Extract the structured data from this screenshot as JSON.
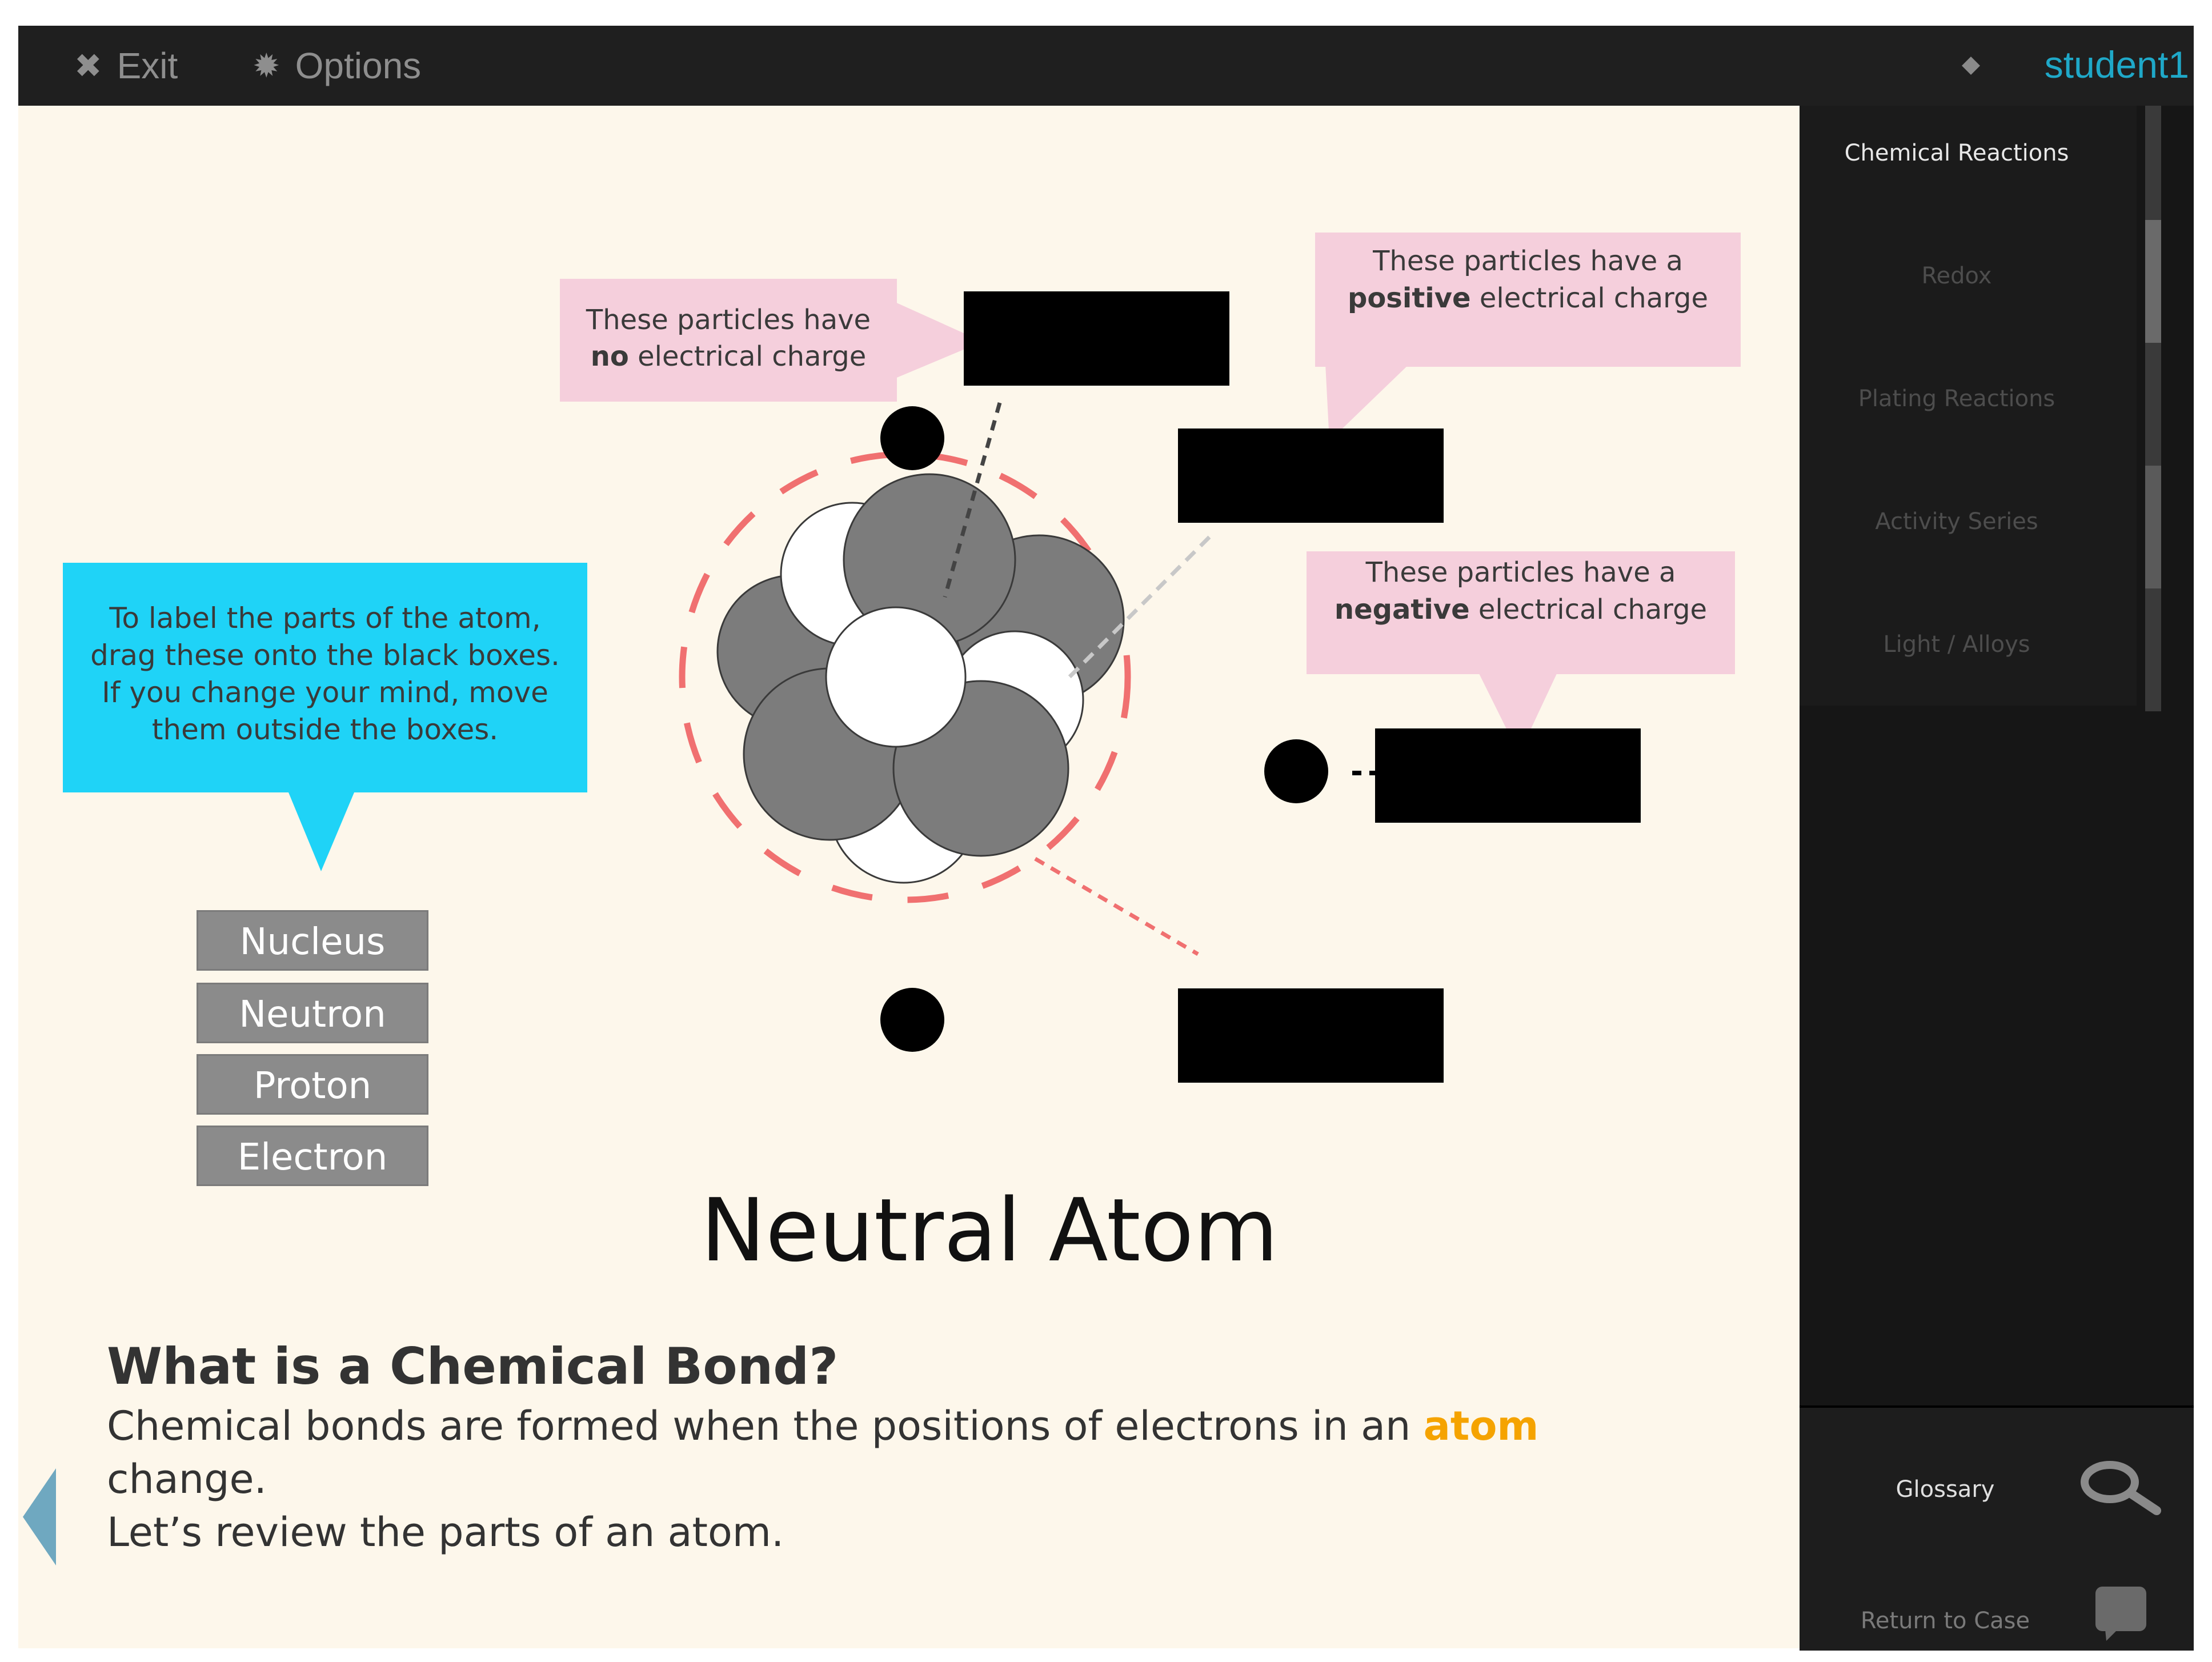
{
  "topbar": {
    "exit_label": "Exit",
    "options_label": "Options",
    "user_name": "student1",
    "exit_icon": "close-icon",
    "options_icon": "gear-icon"
  },
  "sidebar": {
    "items": [
      {
        "label": "Chemical Reactions",
        "active": true
      },
      {
        "label": "Redox",
        "active": false
      },
      {
        "label": "Plating Reactions",
        "active": false
      },
      {
        "label": "Activity Series",
        "active": false
      },
      {
        "label": "Light / Alloys",
        "active": false
      }
    ],
    "glossary_label": "Glossary",
    "return_label": "Return to Case"
  },
  "instructions": {
    "text": "To label the parts of the atom, drag these onto the black boxes. If you change your mind, move them outside the boxes."
  },
  "callouts": {
    "neutral_pre": "These particles have",
    "neutral_bold": "no",
    "neutral_post": "electrical charge",
    "positive_pre": "These particles have a",
    "positive_bold": "positive",
    "positive_post": "electrical charge",
    "negative_pre": "These particles have a",
    "negative_bold": "negative",
    "negative_post": "electrical charge"
  },
  "labels": [
    "Nucleus",
    "Neutron",
    "Proton",
    "Electron"
  ],
  "title": "Neutral Atom",
  "section": {
    "heading": "What is a Chemical Bond?",
    "body_pre": "Chemical bonds are formed when the positions of electrons in an",
    "body_highlight": "atom",
    "body_post": "change.",
    "body_line2": "Let’s review the parts of an atom."
  },
  "colors": {
    "topbar": "#1f1f1f",
    "content_bg": "#fdf7eb",
    "accent_cyan": "#1fd3f7",
    "callout_pink": "#f5cfdc",
    "highlight": "#f5a300",
    "username": "#1fa8c8",
    "orbit_dash": "#f07070"
  }
}
